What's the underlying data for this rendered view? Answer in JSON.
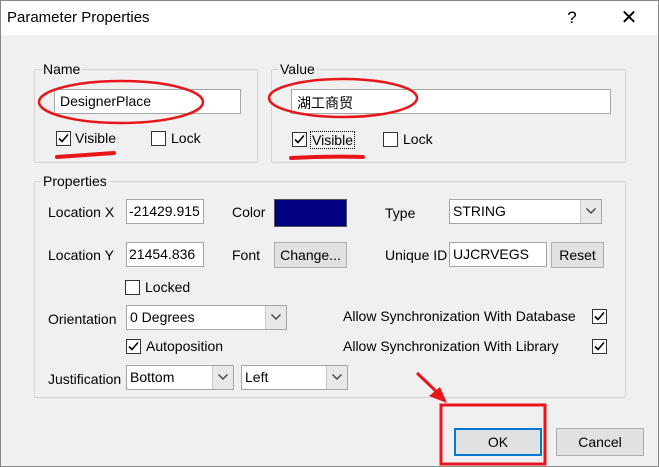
{
  "window": {
    "title": "Parameter Properties",
    "help_glyph": "?",
    "close_glyph": "✕"
  },
  "name_group": {
    "label": "Name",
    "value": "DesignerPlace",
    "visible_label": "Visible",
    "lock_label": "Lock",
    "visible_checked": true,
    "lock_checked": false
  },
  "value_group": {
    "label": "Value",
    "value": "湖工商贸",
    "visible_label": "Visible",
    "lock_label": "Lock",
    "visible_checked": true,
    "lock_checked": false
  },
  "properties": {
    "label": "Properties",
    "location_x_label": "Location X",
    "location_x_value": "-21429.915",
    "location_y_label": "Location Y",
    "location_y_value": "21454.836",
    "color_label": "Color",
    "color_value": "#000080",
    "font_label": "Font",
    "change_button": "Change...",
    "type_label": "Type",
    "type_value": "STRING",
    "unique_id_label": "Unique ID",
    "unique_id_value": "UJCRVEGS",
    "reset_button": "Reset",
    "locked_label": "Locked",
    "locked_checked": false,
    "orientation_label": "Orientation",
    "orientation_value": "0 Degrees",
    "autoposition_label": "Autoposition",
    "autoposition_checked": true,
    "justification_label": "Justification",
    "justification_v_value": "Bottom",
    "justification_h_value": "Left",
    "sync_db_label": "Allow Synchronization With Database",
    "sync_db_checked": true,
    "sync_lib_label": "Allow Synchronization With Library",
    "sync_lib_checked": true
  },
  "footer": {
    "ok_button": "OK",
    "cancel_button": "Cancel"
  },
  "annotations": {
    "color": "#e8161b"
  }
}
